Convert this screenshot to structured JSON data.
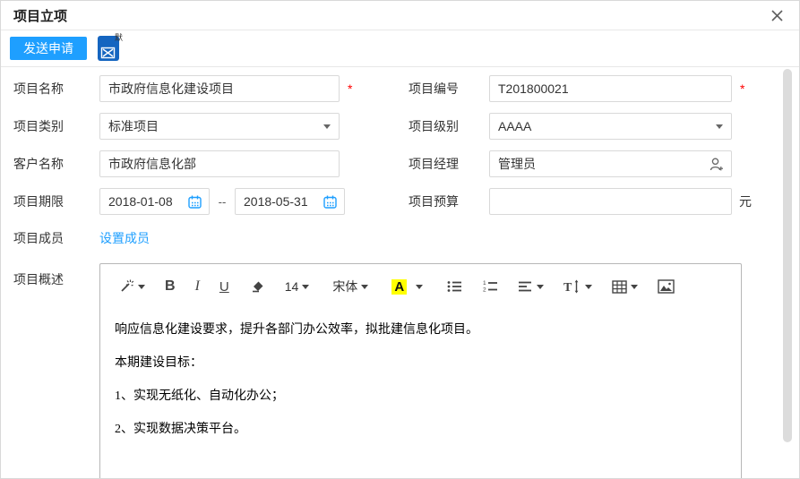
{
  "dialog": {
    "title": "项目立项"
  },
  "toolbar": {
    "send_label": "发送申请",
    "badge_alt": "默"
  },
  "form": {
    "required_marker": "*",
    "project_name": {
      "label": "项目名称",
      "value": "市政府信息化建设项目"
    },
    "project_code": {
      "label": "项目编号",
      "value": "T201800021"
    },
    "project_type": {
      "label": "项目类别",
      "value": "标准项目"
    },
    "project_level": {
      "label": "项目级别",
      "value": "AAAA"
    },
    "customer_name": {
      "label": "客户名称",
      "value": "市政府信息化部"
    },
    "project_manager": {
      "label": "项目经理",
      "value": "管理员"
    },
    "project_period": {
      "label": "项目期限",
      "start": "2018-01-08",
      "separator": "--",
      "end": "2018-05-31"
    },
    "project_budget": {
      "label": "项目预算",
      "unit": "元"
    },
    "project_members": {
      "label": "项目成员",
      "link": "设置成员"
    },
    "project_summary": {
      "label": "项目概述"
    }
  },
  "editor": {
    "toolbar": {
      "bold": "B",
      "italic": "I",
      "underline": "U",
      "font_size": "14",
      "font_family": "宋体",
      "font_color": "A"
    },
    "content": [
      "响应信息化建设要求，提升各部门办公效率，拟批建信息化项目。",
      "本期建设目标：",
      "1、实现无纸化、自动化办公；",
      "2、实现数据决策平台。"
    ]
  },
  "colors": {
    "accent": "#1E9FFF",
    "required": "#FF0000",
    "highlight": "#FFFF00",
    "badge": "#1565C0",
    "link": "#1E9FFF"
  }
}
